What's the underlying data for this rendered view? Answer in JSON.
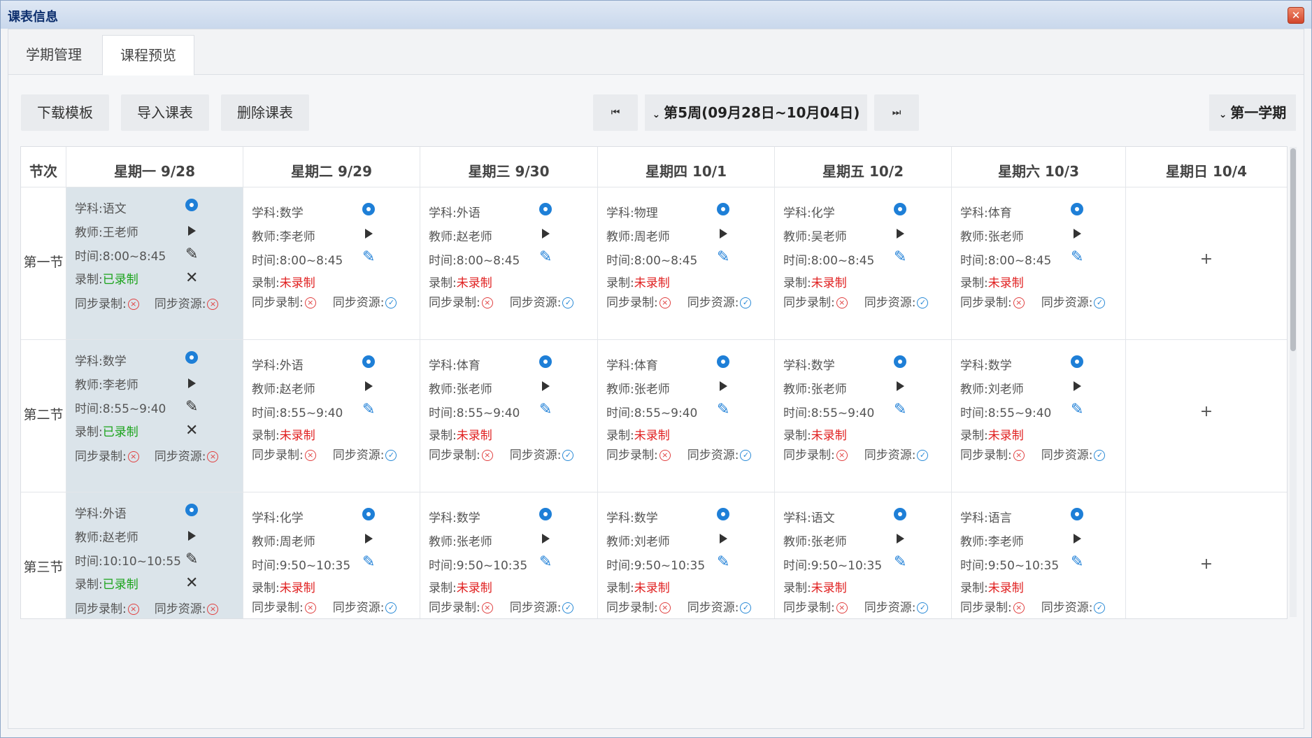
{
  "window": {
    "title": "课表信息",
    "close_label": "✕"
  },
  "tabs": [
    {
      "label": "学期管理"
    },
    {
      "label": "课程预览"
    }
  ],
  "toolbar": {
    "download_label": "下载模板",
    "import_label": "导入课表",
    "delete_label": "删除课表",
    "first_label": "⏮",
    "week_label": "第5周(09月28日~10月04日)",
    "last_label": "⏭",
    "semester_label": "第一学期"
  },
  "schedule": {
    "period_header": "节次",
    "days": [
      "星期一 9/28",
      "星期二 9/29",
      "星期三 9/30",
      "星期四 10/1",
      "星期五 10/2",
      "星期六 10/3",
      "星期日 10/4"
    ],
    "periods": [
      "第一节",
      "第二节",
      "第三节"
    ],
    "add_label": "+",
    "cells": [
      [
        {
          "subject": "学科:语文",
          "teacher": "教师:王老师",
          "time": "时间:8:00~8:45",
          "rec_label": "录制:",
          "rec_status": "已录制",
          "sync_rec": "同步录制:",
          "sync_res": "同步资源:"
        },
        {
          "subject": "学科:数学",
          "teacher": "教师:李老师",
          "time": "时间:8:00~8:45",
          "rec_label": "录制:",
          "rec_status": "未录制",
          "sync_rec": "同步录制:",
          "sync_res": "同步资源:"
        },
        {
          "subject": "学科:外语",
          "teacher": "教师:赵老师",
          "time": "时间:8:00~8:45",
          "rec_label": "录制:",
          "rec_status": "未录制",
          "sync_rec": "同步录制:",
          "sync_res": "同步资源:"
        },
        {
          "subject": "学科:物理",
          "teacher": "教师:周老师",
          "time": "时间:8:00~8:45",
          "rec_label": "录制:",
          "rec_status": "未录制",
          "sync_rec": "同步录制:",
          "sync_res": "同步资源:"
        },
        {
          "subject": "学科:化学",
          "teacher": "教师:吴老师",
          "time": "时间:8:00~8:45",
          "rec_label": "录制:",
          "rec_status": "未录制",
          "sync_rec": "同步录制:",
          "sync_res": "同步资源:"
        },
        {
          "subject": "学科:体育",
          "teacher": "教师:张老师",
          "time": "时间:8:00~8:45",
          "rec_label": "录制:",
          "rec_status": "未录制",
          "sync_rec": "同步录制:",
          "sync_res": "同步资源:"
        }
      ],
      [
        {
          "subject": "学科:数学",
          "teacher": "教师:李老师",
          "time": "时间:8:55~9:40",
          "rec_label": "录制:",
          "rec_status": "已录制",
          "sync_rec": "同步录制:",
          "sync_res": "同步资源:"
        },
        {
          "subject": "学科:外语",
          "teacher": "教师:赵老师",
          "time": "时间:8:55~9:40",
          "rec_label": "录制:",
          "rec_status": "未录制",
          "sync_rec": "同步录制:",
          "sync_res": "同步资源:"
        },
        {
          "subject": "学科:体育",
          "teacher": "教师:张老师",
          "time": "时间:8:55~9:40",
          "rec_label": "录制:",
          "rec_status": "未录制",
          "sync_rec": "同步录制:",
          "sync_res": "同步资源:"
        },
        {
          "subject": "学科:体育",
          "teacher": "教师:张老师",
          "time": "时间:8:55~9:40",
          "rec_label": "录制:",
          "rec_status": "未录制",
          "sync_rec": "同步录制:",
          "sync_res": "同步资源:"
        },
        {
          "subject": "学科:数学",
          "teacher": "教师:张老师",
          "time": "时间:8:55~9:40",
          "rec_label": "录制:",
          "rec_status": "未录制",
          "sync_rec": "同步录制:",
          "sync_res": "同步资源:"
        },
        {
          "subject": "学科:数学",
          "teacher": "教师:刘老师",
          "time": "时间:8:55~9:40",
          "rec_label": "录制:",
          "rec_status": "未录制",
          "sync_rec": "同步录制:",
          "sync_res": "同步资源:"
        }
      ],
      [
        {
          "subject": "学科:外语",
          "teacher": "教师:赵老师",
          "time": "时间:10:10~10:55",
          "rec_label": "录制:",
          "rec_status": "已录制",
          "sync_rec": "同步录制:",
          "sync_res": "同步资源:"
        },
        {
          "subject": "学科:化学",
          "teacher": "教师:周老师",
          "time": "时间:9:50~10:35",
          "rec_label": "录制:",
          "rec_status": "未录制",
          "sync_rec": "同步录制:",
          "sync_res": "同步资源:"
        },
        {
          "subject": "学科:数学",
          "teacher": "教师:张老师",
          "time": "时间:9:50~10:35",
          "rec_label": "录制:",
          "rec_status": "未录制",
          "sync_rec": "同步录制:",
          "sync_res": "同步资源:"
        },
        {
          "subject": "学科:数学",
          "teacher": "教师:刘老师",
          "time": "时间:9:50~10:35",
          "rec_label": "录制:",
          "rec_status": "未录制",
          "sync_rec": "同步录制:",
          "sync_res": "同步资源:"
        },
        {
          "subject": "学科:语文",
          "teacher": "教师:张老师",
          "time": "时间:9:50~10:35",
          "rec_label": "录制:",
          "rec_status": "未录制",
          "sync_rec": "同步录制:",
          "sync_res": "同步资源:"
        },
        {
          "subject": "学科:语言",
          "teacher": "教师:李老师",
          "time": "时间:9:50~10:35",
          "rec_label": "录制:",
          "rec_status": "未录制",
          "sync_rec": "同步录制:",
          "sync_res": "同步资源:"
        }
      ]
    ]
  }
}
